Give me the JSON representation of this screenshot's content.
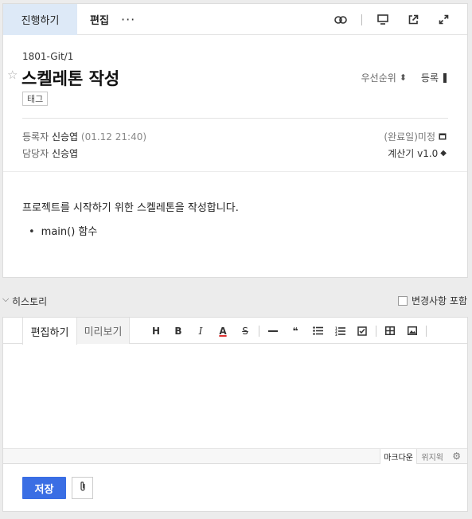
{
  "header": {
    "tab_progress": "진행하기",
    "tab_edit": "편집",
    "more": "···"
  },
  "issue": {
    "path": "1801-Git/1",
    "title": "스켈레톤 작성",
    "priority_label": "우선순위",
    "register_label": "등록",
    "tag": "태그",
    "reporter_label": "등록자",
    "reporter_name": "신승엽",
    "reporter_date": "(01.12 21:40)",
    "assignee_label": "담당자",
    "assignee_name": "신승엽",
    "status": "(완료일)미정",
    "version": "계산기 v1.0"
  },
  "body": {
    "description": "프로젝트를 시작하기 위한 스켈레톤을 작성합니다.",
    "bullets": [
      "main() 함수"
    ]
  },
  "history": {
    "label": "히스토리",
    "include_changes": "변경사항 포함"
  },
  "editor": {
    "tab_edit": "편집하기",
    "tab_preview": "미리보기",
    "tools": {
      "heading": "H",
      "bold": "B",
      "italic": "I",
      "color": "A",
      "strike": "S",
      "quote": "❝"
    },
    "mode_markdown": "마크다운",
    "mode_wysiwyg": "위지윅"
  },
  "footer": {
    "save": "저장"
  },
  "colors": {
    "accent": "#3a6ee4",
    "tab_active_bg": "#dde9f7"
  }
}
